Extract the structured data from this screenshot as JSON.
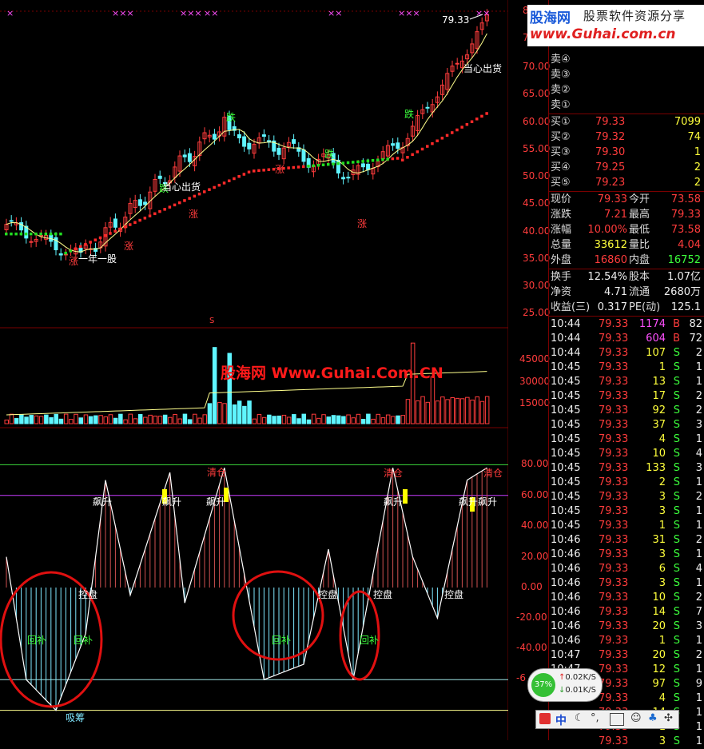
{
  "price_chart": {
    "axis_ticks": [
      "70.00",
      "65.00",
      "60.00",
      "55.00",
      "50.00",
      "45.00",
      "40.00",
      "35.00",
      "30.00",
      "25.00"
    ],
    "partial_ticks": [
      "8",
      "7"
    ],
    "last_price_label": "79.33",
    "annotations": [
      {
        "text": "一年一股",
        "color": "#ffffff"
      },
      {
        "text": "跌",
        "color": "#3cff3c"
      },
      {
        "text": "跌",
        "color": "#3cff3c"
      },
      {
        "text": "跌",
        "color": "#3cff3c"
      },
      {
        "text": "跌",
        "color": "#3cff3c"
      },
      {
        "text": "涨",
        "color": "#ff3c3c"
      },
      {
        "text": "涨",
        "color": "#ff3c3c"
      },
      {
        "text": "涨",
        "color": "#ff3c3c"
      },
      {
        "text": "涨",
        "color": "#ff3c3c"
      },
      {
        "text": "涨",
        "color": "#ff3c3c"
      },
      {
        "text": "当心出货",
        "color": "#ffffff"
      },
      {
        "text": "当心出货",
        "color": "#ffffff"
      }
    ],
    "s_marker": "S"
  },
  "volume_chart": {
    "axis_ticks": [
      "45000",
      "30000",
      "15000"
    ]
  },
  "osc_chart": {
    "axis_ticks": [
      "80.00",
      "60.00",
      "40.00",
      "20.00",
      "0.00",
      "-20.00",
      "-40.00",
      "-6"
    ],
    "labels": [
      {
        "text": "清仓",
        "color": "#ff3c3c"
      },
      {
        "text": "清仓",
        "color": "#ff3c3c"
      },
      {
        "text": "清仓",
        "color": "#ff3c3c"
      },
      {
        "text": "飙升",
        "color": "#ffffff"
      },
      {
        "text": "飙升",
        "color": "#ffffff"
      },
      {
        "text": "飙升",
        "color": "#ffffff"
      },
      {
        "text": "飙升",
        "color": "#ffffff"
      },
      {
        "text": "飙升",
        "color": "#ffffff"
      },
      {
        "text": "飙升",
        "color": "#ffffff"
      },
      {
        "text": "控盘",
        "color": "#ffffff"
      },
      {
        "text": "控盘",
        "color": "#ffffff"
      },
      {
        "text": "控盘",
        "color": "#ffffff"
      },
      {
        "text": "控盘",
        "color": "#ffffff"
      },
      {
        "text": "回补",
        "color": "#3cff3c"
      },
      {
        "text": "回补",
        "color": "#3cff3c"
      },
      {
        "text": "回补",
        "color": "#3cff3c"
      },
      {
        "text": "回补",
        "color": "#3cff3c"
      },
      {
        "text": "吸筹",
        "color": "#7fe7ff"
      }
    ]
  },
  "watermark_text": "股海网 Www.Guhai.Com.CN",
  "logo": {
    "line1_brand": "股海网",
    "line1_slogan": "股票软件资源分享",
    "line2": "www.Guhai.com.cn"
  },
  "order_book": {
    "sell": [
      {
        "label": "卖④"
      },
      {
        "label": "卖③"
      },
      {
        "label": "卖②"
      },
      {
        "label": "卖①"
      }
    ],
    "buy": [
      {
        "label": "买①",
        "price": "79.33",
        "vol": "7099"
      },
      {
        "label": "买②",
        "price": "79.32",
        "vol": "74"
      },
      {
        "label": "买③",
        "price": "79.30",
        "vol": "1"
      },
      {
        "label": "买④",
        "price": "79.25",
        "vol": "2"
      },
      {
        "label": "买⑤",
        "price": "79.23",
        "vol": "2"
      }
    ]
  },
  "quote": [
    {
      "l1": "现价",
      "v1": "79.33",
      "c1": "red",
      "l2": "今开",
      "v2": "73.58",
      "c2": "red"
    },
    {
      "l1": "涨跌",
      "v1": "7.21",
      "c1": "red",
      "l2": "最高",
      "v2": "79.33",
      "c2": "red"
    },
    {
      "l1": "涨幅",
      "v1": "10.00%",
      "c1": "red",
      "l2": "最低",
      "v2": "73.58",
      "c2": "red"
    },
    {
      "l1": "总量",
      "v1": "33612",
      "c1": "yellow",
      "l2": "量比",
      "v2": "4.04",
      "c2": "red"
    },
    {
      "l1": "外盘",
      "v1": "16860",
      "c1": "red",
      "l2": "内盘",
      "v2": "16752",
      "c2": "green"
    }
  ],
  "fundamentals": [
    {
      "l1": "换手",
      "v1": "12.54%",
      "l2": "股本",
      "v2": "1.07亿"
    },
    {
      "l1": "净资",
      "v1": "4.71",
      "l2": "流通",
      "v2": "2680万"
    },
    {
      "l1": "收益(三)",
      "v1": "0.317",
      "l2": "PE(动)",
      "v2": "125.1"
    }
  ],
  "ticks": [
    {
      "t": "10:44",
      "p": "79.33",
      "v": "1174",
      "f": "B",
      "n": "82",
      "vc": "magenta"
    },
    {
      "t": "10:44",
      "p": "79.33",
      "v": "604",
      "f": "B",
      "n": "72",
      "vc": "magenta"
    },
    {
      "t": "10:44",
      "p": "79.33",
      "v": "107",
      "f": "S",
      "n": "2",
      "vc": "yellow"
    },
    {
      "t": "10:45",
      "p": "79.33",
      "v": "1",
      "f": "S",
      "n": "1",
      "vc": "yellow"
    },
    {
      "t": "10:45",
      "p": "79.33",
      "v": "13",
      "f": "S",
      "n": "1",
      "vc": "yellow"
    },
    {
      "t": "10:45",
      "p": "79.33",
      "v": "17",
      "f": "S",
      "n": "2",
      "vc": "yellow"
    },
    {
      "t": "10:45",
      "p": "79.33",
      "v": "92",
      "f": "S",
      "n": "2",
      "vc": "yellow"
    },
    {
      "t": "10:45",
      "p": "79.33",
      "v": "37",
      "f": "S",
      "n": "3",
      "vc": "yellow"
    },
    {
      "t": "10:45",
      "p": "79.33",
      "v": "4",
      "f": "S",
      "n": "1",
      "vc": "yellow"
    },
    {
      "t": "10:45",
      "p": "79.33",
      "v": "10",
      "f": "S",
      "n": "4",
      "vc": "yellow"
    },
    {
      "t": "10:45",
      "p": "79.33",
      "v": "133",
      "f": "S",
      "n": "3",
      "vc": "yellow"
    },
    {
      "t": "10:45",
      "p": "79.33",
      "v": "2",
      "f": "S",
      "n": "1",
      "vc": "yellow"
    },
    {
      "t": "10:45",
      "p": "79.33",
      "v": "3",
      "f": "S",
      "n": "2",
      "vc": "yellow"
    },
    {
      "t": "10:45",
      "p": "79.33",
      "v": "3",
      "f": "S",
      "n": "1",
      "vc": "yellow"
    },
    {
      "t": "10:45",
      "p": "79.33",
      "v": "1",
      "f": "S",
      "n": "1",
      "vc": "yellow"
    },
    {
      "t": "10:46",
      "p": "79.33",
      "v": "31",
      "f": "S",
      "n": "2",
      "vc": "yellow"
    },
    {
      "t": "10:46",
      "p": "79.33",
      "v": "3",
      "f": "S",
      "n": "1",
      "vc": "yellow"
    },
    {
      "t": "10:46",
      "p": "79.33",
      "v": "6",
      "f": "S",
      "n": "4",
      "vc": "yellow"
    },
    {
      "t": "10:46",
      "p": "79.33",
      "v": "3",
      "f": "S",
      "n": "1",
      "vc": "yellow"
    },
    {
      "t": "10:46",
      "p": "79.33",
      "v": "10",
      "f": "S",
      "n": "2",
      "vc": "yellow"
    },
    {
      "t": "10:46",
      "p": "79.33",
      "v": "14",
      "f": "S",
      "n": "7",
      "vc": "yellow"
    },
    {
      "t": "10:46",
      "p": "79.33",
      "v": "20",
      "f": "S",
      "n": "3",
      "vc": "yellow"
    },
    {
      "t": "10:46",
      "p": "79.33",
      "v": "1",
      "f": "S",
      "n": "1",
      "vc": "yellow"
    },
    {
      "t": "10:47",
      "p": "79.33",
      "v": "20",
      "f": "S",
      "n": "2",
      "vc": "yellow"
    },
    {
      "t": "10:47",
      "p": "79.33",
      "v": "12",
      "f": "S",
      "n": "1",
      "vc": "yellow"
    },
    {
      "t": "10:47",
      "p": "79.33",
      "v": "97",
      "f": "S",
      "n": "9",
      "vc": "yellow"
    },
    {
      "t": "",
      "p": "79.33",
      "v": "4",
      "f": "S",
      "n": "1",
      "vc": "yellow"
    },
    {
      "t": "",
      "p": "79.33",
      "v": "14",
      "f": "S",
      "n": "1",
      "vc": "yellow"
    },
    {
      "t": "",
      "p": "79.33",
      "v": "1",
      "f": "S",
      "n": "1",
      "vc": "yellow"
    },
    {
      "t": "",
      "p": "79.33",
      "v": "3",
      "f": "S",
      "n": "1",
      "vc": "yellow"
    },
    {
      "t": "",
      "p": "79.33",
      "v": "24",
      "f": "S",
      "n": "1",
      "vc": "yellow"
    }
  ],
  "net_widget": {
    "percent": "37%",
    "up": "0.02K/S",
    "down": "0.01K/S"
  },
  "ime_bar": {
    "label": "中"
  },
  "colors": {
    "up": "#ff3c3c",
    "down": "#5ff5ff",
    "ma": "#ffff8c",
    "grid_red": "#7a0000"
  }
}
